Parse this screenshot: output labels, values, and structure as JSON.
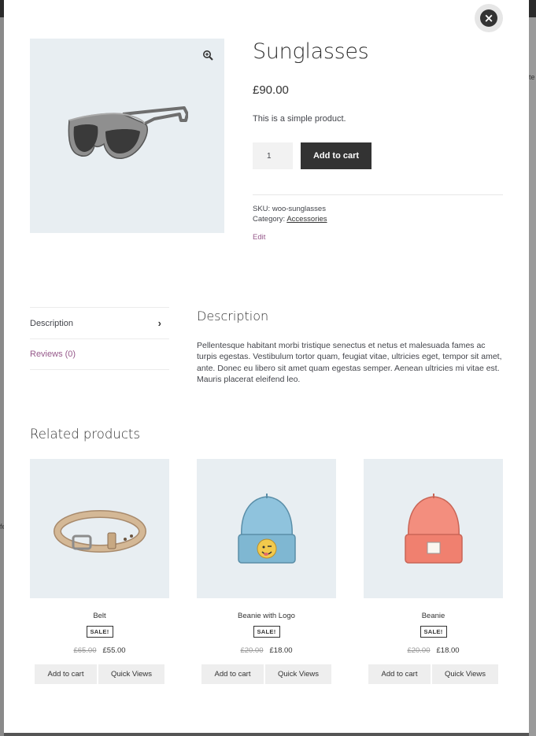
{
  "backdrop": {
    "ghost_a": "te",
    "ghost_b": "fe"
  },
  "modal": {
    "close_label": "×"
  },
  "product": {
    "title": "Sunglasses",
    "price": "£90.00",
    "short_description": "This is a simple product.",
    "quantity": "1",
    "add_to_cart_label": "Add to cart",
    "sku_label": "SKU:",
    "sku": "woo-sunglasses",
    "category_label": "Category:",
    "category": "Accessories",
    "edit_label": "Edit"
  },
  "tabs": [
    {
      "label": "Description"
    },
    {
      "label": "Reviews (0)"
    }
  ],
  "description": {
    "heading": "Description",
    "body": "Pellentesque habitant morbi tristique senectus et netus et malesuada fames ac turpis egestas. Vestibulum tortor quam, feugiat vitae, ultricies eget, tempor sit amet, ante. Donec eu libero sit amet quam egestas semper. Aenean ultricies mi vitae est. Mauris placerat eleifend leo."
  },
  "related": {
    "title": "Related products",
    "items": [
      {
        "name": "Belt",
        "badge": "SALE!",
        "old_price": "£65.00",
        "price": "£55.00",
        "cart_label": "Add to cart",
        "quick_label": "Quick Views"
      },
      {
        "name": "Beanie with Logo",
        "badge": "SALE!",
        "old_price": "£20.00",
        "price": "£18.00",
        "cart_label": "Add to cart",
        "quick_label": "Quick Views"
      },
      {
        "name": "Beanie",
        "badge": "SALE!",
        "old_price": "£20.00",
        "price": "£18.00",
        "cart_label": "Add to cart",
        "quick_label": "Quick Views"
      }
    ]
  },
  "colors": {
    "accent": "#96588a",
    "button_dark": "#333333",
    "image_bg": "#e8eef2"
  }
}
